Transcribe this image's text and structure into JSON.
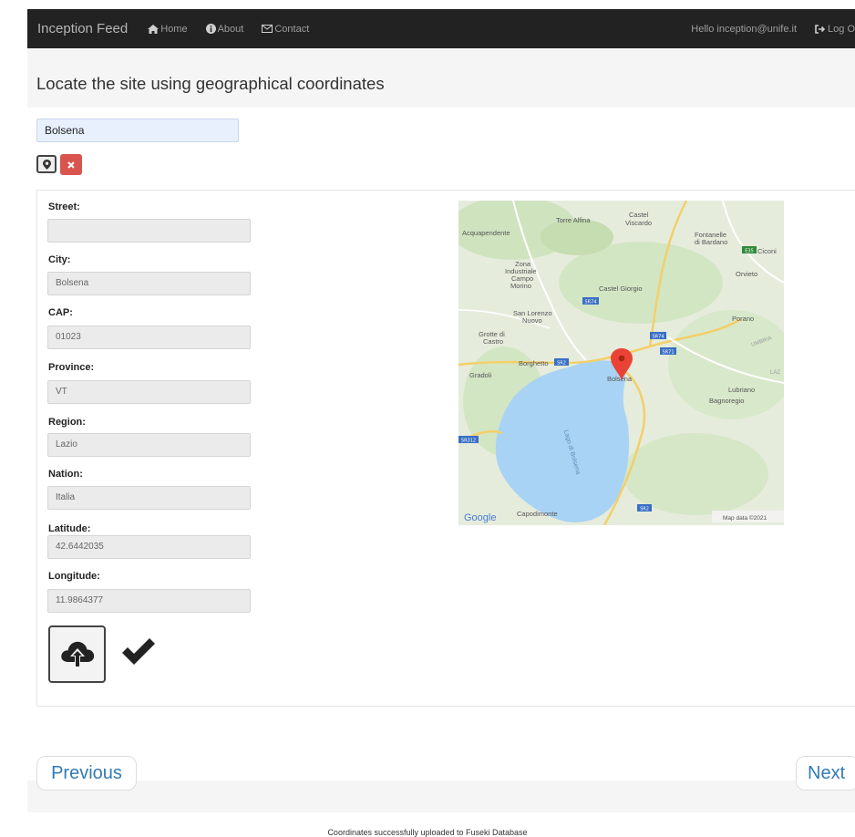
{
  "navbar": {
    "brand": "Inception Feed",
    "links": [
      {
        "label": "Home",
        "icon": "home-icon"
      },
      {
        "label": "About",
        "icon": "info-icon"
      },
      {
        "label": "Contact",
        "icon": "envelope-icon"
      }
    ],
    "greeting": "Hello inception@unife.it",
    "logout_label": "Log O"
  },
  "page": {
    "title": "Locate the site using geographical coordinates"
  },
  "search": {
    "value": "Bolsena",
    "locate_icon": "map-marker-icon",
    "clear_icon": "close-icon"
  },
  "fields": [
    {
      "label": "Street:",
      "value": ""
    },
    {
      "label": "City:",
      "value": "Bolsena"
    },
    {
      "label": "CAP:",
      "value": "01023"
    },
    {
      "label": "Province:",
      "value": "VT"
    },
    {
      "label": "Region:",
      "value": "Lazio"
    },
    {
      "label": "Nation:",
      "value": "Italia"
    },
    {
      "label": "Latitude:",
      "value": "42.6442035"
    },
    {
      "label": "Longitude:",
      "value": "11.9864377"
    }
  ],
  "actions": {
    "upload_icon": "cloud-upload-icon",
    "done_icon": "checkmark-icon"
  },
  "map": {
    "places": {
      "torre_alfina": "Torre Alfina",
      "castel": "Castel",
      "viscardo": "Viscardo",
      "acquapendente": "Acquapendente",
      "fontanelle": "Fontanelle",
      "di_bardano": "di Bardano",
      "ciconia": "Ciconi",
      "zona": "Zona",
      "industriale": "Industriale",
      "campo": "Campo",
      "morino": "Morino",
      "orvieto": "Orvieto",
      "castel_giorgio": "Castel Giorgio",
      "san_lorenzo": "San Lorenzo",
      "nuovo": "Nuovo",
      "porano": "Porano",
      "grotte_di": "Grotte di",
      "castro": "Castro",
      "umbria": "UMBRIA",
      "borghetto": "Borghetto",
      "gradoli": "Gradoli",
      "bolsena": "Bolsena",
      "lazio": "LAZ",
      "lubriano": "Lubriano",
      "bagnoregio": "Bagnoregio",
      "lago": "Lago di Bolsena",
      "capodimonte": "Capodimonte"
    },
    "roads": {
      "sr74a": "SR74",
      "sr74b": "SR74",
      "sr71": "SR71",
      "sr2a": "SR2",
      "sr2b": "SR2",
      "sr312": "SR312",
      "e35": "E35"
    },
    "google": "Google",
    "attribution": "Map data ©2021"
  },
  "pager": {
    "previous": "Previous",
    "next": "Next"
  },
  "status": "Coordinates successfully uploaded to Fuseki Database",
  "colors": {
    "navbar": "#222222",
    "danger": "#d9534f",
    "link": "#337ab7",
    "lake": "#a8d3f4",
    "marker": "#ea4335"
  }
}
